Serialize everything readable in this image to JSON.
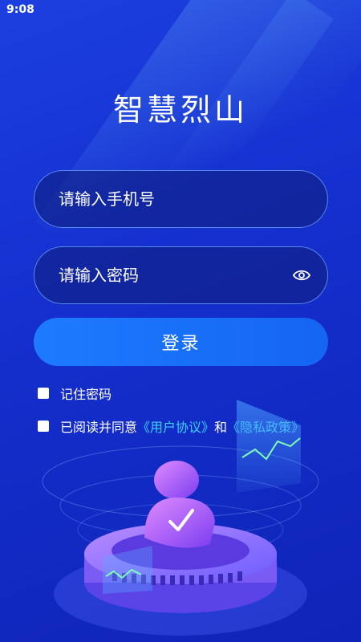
{
  "status_bar": {
    "time": "9:08"
  },
  "app": {
    "title": "智慧烈山"
  },
  "login_form": {
    "phone_placeholder": "请输入手机号",
    "password_placeholder": "请输入密码",
    "login_label": "登录"
  },
  "options": {
    "remember_label": "记住密码",
    "agree_prefix": "已阅读并同意",
    "user_agreement": "《用户协议》",
    "and_text": "和",
    "privacy_policy": "《隐私政策》"
  },
  "colors": {
    "background": "#1530cf",
    "button": "#1d7bff",
    "link": "#3fd0ff"
  },
  "icons": {
    "password_toggle": "eye-icon",
    "illustration": "user-verified-illustration"
  }
}
